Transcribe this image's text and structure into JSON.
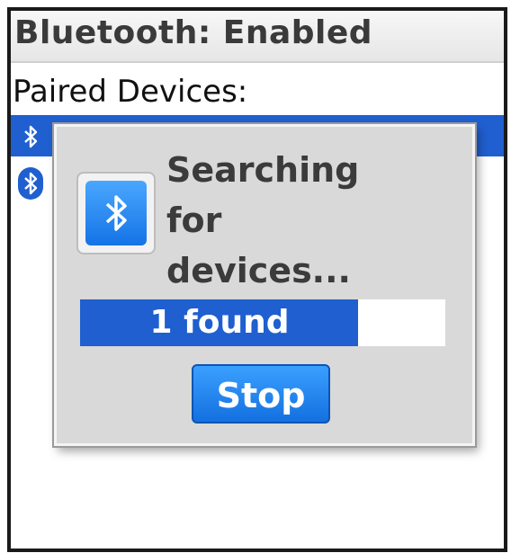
{
  "header": {
    "title": "Bluetooth: Enabled"
  },
  "paired_devices": {
    "label": "Paired Devices:",
    "items": [
      {
        "icon": "bluetooth-icon",
        "selected": true
      },
      {
        "icon": "bluetooth-icon",
        "selected": false
      }
    ]
  },
  "dialog": {
    "icon": "bluetooth-icon",
    "message": "Searching\nfor\ndevices...",
    "progress": {
      "text": "1 found",
      "fraction": 0.76
    },
    "stop_label": "Stop"
  },
  "colors": {
    "accent": "#1f5fcf",
    "button": "#1a7fe9",
    "dialog_bg": "#d9d9d9"
  }
}
